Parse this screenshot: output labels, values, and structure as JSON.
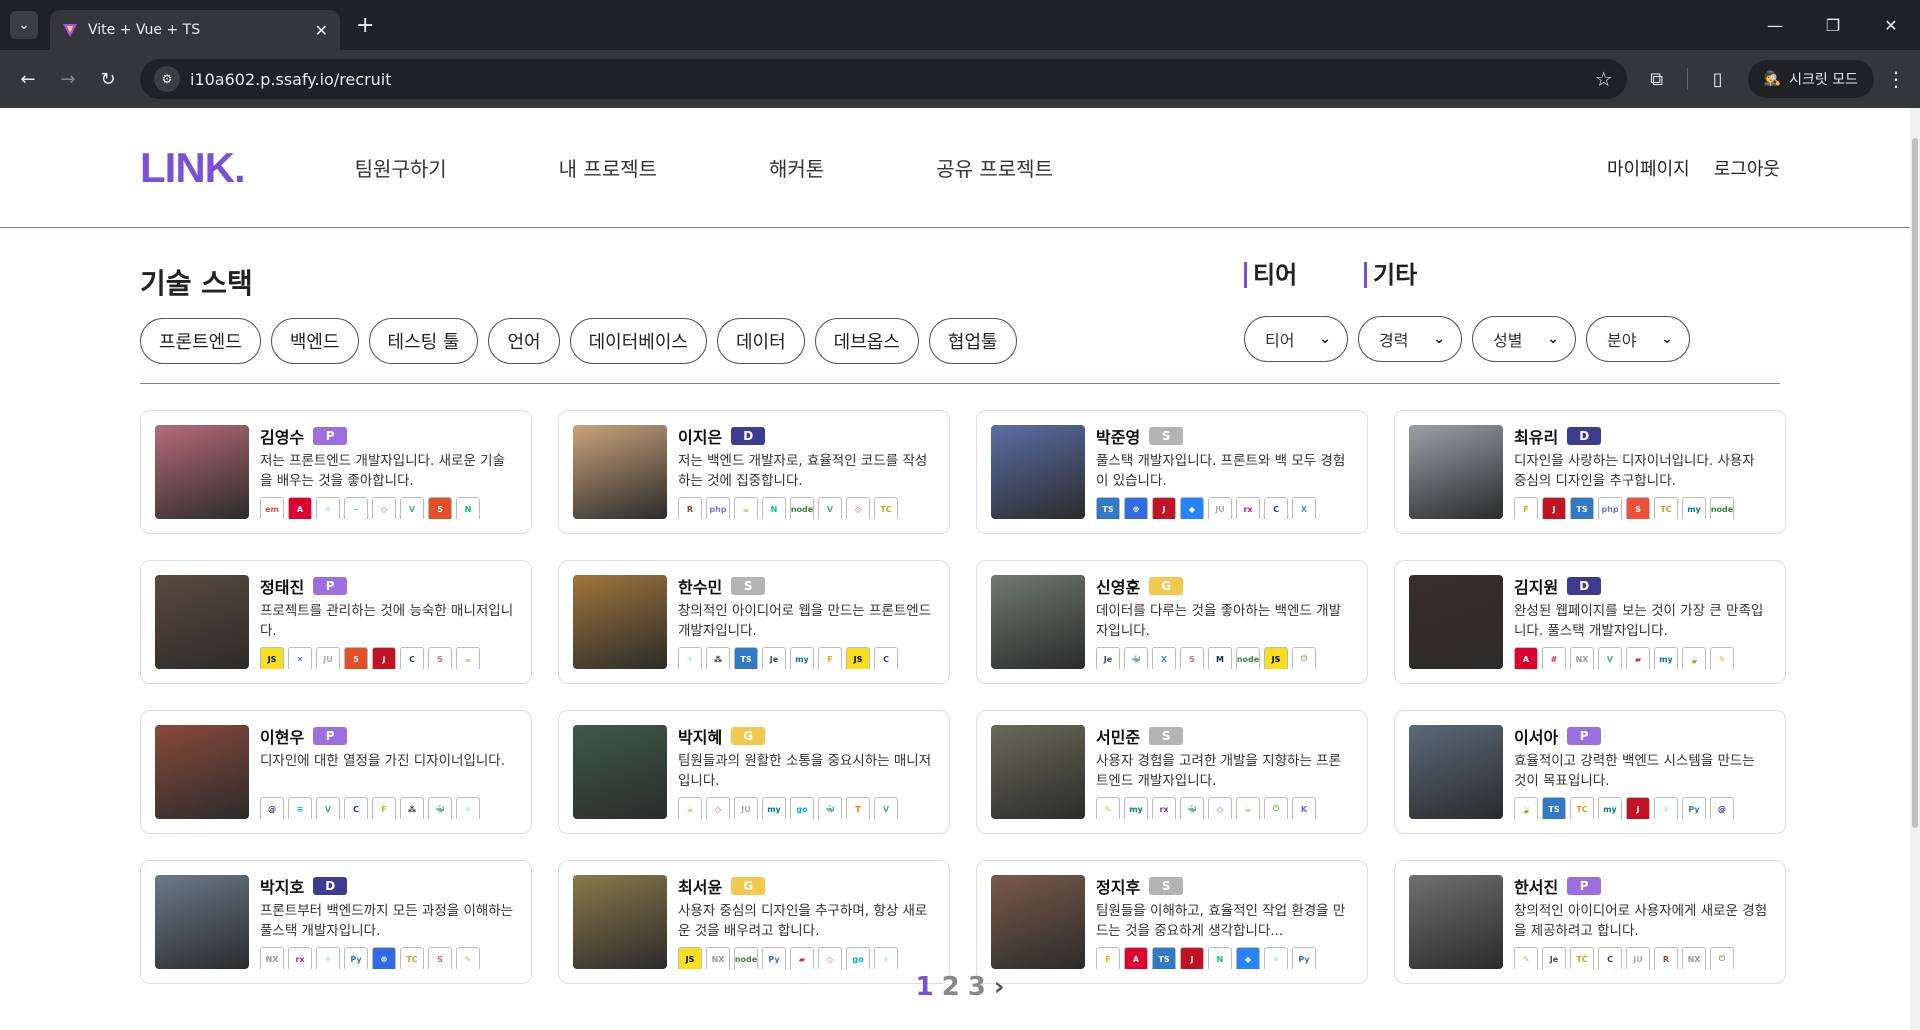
{
  "browser": {
    "tab_title": "Vite + Vue + TS",
    "url": "i10a602.p.ssafy.io/recruit",
    "incognito_label": "시크릿 모드"
  },
  "header": {
    "logo": "LINK.",
    "nav": [
      "팀원구하기",
      "내 프로젝트",
      "해커톤",
      "공유 프로젝트"
    ],
    "mypage": "마이페이지",
    "logout": "로그아웃"
  },
  "filters": {
    "stack_title": "기술 스택",
    "stack_buttons": [
      "프론트엔드",
      "백엔드",
      "테스팅 툴",
      "언어",
      "데이터베이스",
      "데이터",
      "데브옵스",
      "협업툴"
    ],
    "tier_title": "티어",
    "etc_title": "기타",
    "selects": [
      "티어",
      "경력",
      "성별",
      "분야"
    ]
  },
  "tier_colors": {
    "P": "#9b6fe0",
    "D": "#3d3b8e",
    "S": "#b3b3b3",
    "G": "#f2c94c"
  },
  "photo_colors": [
    "#b86a7a",
    "#c9a27a",
    "#5b6ea6",
    "#9aa0a6",
    "#5a4a3e",
    "#a0763a",
    "#6f7a72",
    "#3a2e2a",
    "#8a4a3a",
    "#3e5a4a",
    "#6a6a5a",
    "#5a6a7a",
    "#6a7a8a",
    "#8a7a4a",
    "#7a5a4a",
    "#707070"
  ],
  "members": [
    {
      "name": "김영수",
      "tier": "P",
      "desc": "저는 프론트엔드 개발자입니다. 새로운 기술을 배우는 것을 좋아합니다.",
      "icons": [
        "ember",
        "angular",
        "react",
        "tailwind",
        "graphql",
        "vue",
        "html5",
        "nuxt"
      ]
    },
    {
      "name": "이지은",
      "tier": "D",
      "desc": "저는 백엔드 개발자로, 효율적인 코드를 작성하는 것에 집중합니다.",
      "icons": [
        "rust",
        "php",
        "java",
        "nuxt",
        "node",
        "vue",
        "graphql",
        "tomcat"
      ]
    },
    {
      "name": "박준영",
      "tier": "S",
      "desc": "풀스택 개발자입니다. 프론트와 백 모두 경험이 있습니다.",
      "icons": [
        "ts",
        "k8s",
        "jest",
        "jira",
        "junit",
        "rxjs",
        "c",
        "xamarin"
      ]
    },
    {
      "name": "최유리",
      "tier": "D",
      "desc": "디자인을 사랑하는 디자이너입니다. 사용자 중심의 디자인을 추구합니다.",
      "icons": [
        "firebase",
        "jest",
        "ts",
        "php",
        "swift",
        "tomcat",
        "mysql",
        "node"
      ]
    },
    {
      "name": "정태진",
      "tier": "P",
      "desc": "프로젝트를 관리하는 것에 능숙한 매니저입니다.",
      "icons": [
        "js",
        "confluence",
        "junit",
        "html5",
        "jest",
        "c",
        "sass",
        "java"
      ]
    },
    {
      "name": "한수민",
      "tier": "S",
      "desc": "창의적인 아이디어로 웹을 만드는 프론트엔드 개발자입니다.",
      "icons": [
        "react",
        "figma",
        "ts",
        "jenkins",
        "mysql",
        "firebase",
        "js",
        "c"
      ]
    },
    {
      "name": "신영훈",
      "tier": "G",
      "desc": "데이터를 다루는 것을 좋아하는 백엔드 개발자입니다.",
      "icons": [
        "jenkins",
        "docker",
        "xamarin",
        "sass",
        "mariadb",
        "node",
        "js",
        "spring"
      ]
    },
    {
      "name": "김지원",
      "tier": "D",
      "desc": "완성된 웹페이지를 보는 것이 가장 큰 만족입니다. 풀스택 개발자입니다.",
      "icons": [
        "angular",
        "slack",
        "next",
        "vue",
        "redis",
        "mysql",
        "mongo",
        "pen"
      ]
    },
    {
      "name": "이현우",
      "tier": "P",
      "desc": "디자인에 대한 열정을 가진 디자이너입니다.",
      "icons": [
        "apollo",
        "elastic",
        "vue",
        "c",
        "firebase",
        "figma",
        "docker",
        "react"
      ]
    },
    {
      "name": "박지혜",
      "tier": "G",
      "desc": "팀원들과의 원활한 소통을 중요시하는 매니저입니다.",
      "icons": [
        "java",
        "graphql",
        "junit",
        "mysql",
        "go",
        "docker",
        "tensor",
        "vue"
      ]
    },
    {
      "name": "서민준",
      "tier": "S",
      "desc": "사용자 경험을 고려한 개발을 지향하는 프론트엔드 개발자입니다.",
      "icons": [
        "pen",
        "mysql",
        "rxjs",
        "docker",
        "graphql",
        "java",
        "spring",
        "kotlin"
      ]
    },
    {
      "name": "이서아",
      "tier": "P",
      "desc": "효율적이고 강력한 백엔드 시스템을 만드는 것이 목표입니다.",
      "icons": [
        "mongo",
        "ts",
        "tomcat",
        "mysql",
        "jest",
        "react",
        "python",
        "apollo"
      ]
    },
    {
      "name": "박지호",
      "tier": "D",
      "desc": "프론트부터 백엔드까지 모든 과정을 이해하는 풀스택 개발자입니다.",
      "icons": [
        "next",
        "rxjs",
        "react",
        "python",
        "k8s",
        "tomcat",
        "sass",
        "pen"
      ]
    },
    {
      "name": "최서윤",
      "tier": "G",
      "desc": "사용자 중심의 디자인을 추구하며, 항상 새로운 것을 배우려고 합니다.",
      "icons": [
        "js",
        "next",
        "node",
        "python",
        "redis",
        "graphql",
        "go",
        "react"
      ]
    },
    {
      "name": "정지후",
      "tier": "S",
      "desc": "팀원들을 이해하고, 효율적인 작업 환경을 만드는 것을 중요하게 생각합니다...",
      "icons": [
        "firebase",
        "angular",
        "ts",
        "jest",
        "nuxt",
        "jira",
        "react",
        "python"
      ]
    },
    {
      "name": "한서진",
      "tier": "P",
      "desc": "창의적인 아이디어로 사용자에게 새로운 경험을 제공하려고 합니다.",
      "icons": [
        "pen",
        "jenkins",
        "tomcat",
        "c",
        "junit",
        "rust",
        "next",
        "spring"
      ]
    }
  ],
  "icon_styles": {
    "ember": {
      "label": "em",
      "bg": "#fff",
      "fg": "#e04e39"
    },
    "angular": {
      "label": "A",
      "bg": "#dd0031",
      "fg": "#fff"
    },
    "react": {
      "label": "⚛",
      "bg": "#fff",
      "fg": "#61dafb"
    },
    "tailwind": {
      "label": "~",
      "bg": "#fff",
      "fg": "#38bdf8"
    },
    "graphql": {
      "label": "◇",
      "bg": "#fff",
      "fg": "#e535ab"
    },
    "vue": {
      "label": "V",
      "bg": "#fff",
      "fg": "#41b883"
    },
    "html5": {
      "label": "5",
      "bg": "#e34f26",
      "fg": "#fff"
    },
    "nuxt": {
      "label": "N",
      "bg": "#fff",
      "fg": "#00c58e"
    },
    "rust": {
      "label": "R",
      "bg": "#fff",
      "fg": "#8a4b28"
    },
    "php": {
      "label": "php",
      "bg": "#fff",
      "fg": "#777bb3"
    },
    "java": {
      "label": "☕",
      "bg": "#fff",
      "fg": "#e76f00"
    },
    "node": {
      "label": "node",
      "bg": "#fff",
      "fg": "#3c873a"
    },
    "tomcat": {
      "label": "TC",
      "bg": "#fff",
      "fg": "#d1a41a"
    },
    "ts": {
      "label": "TS",
      "bg": "#3178c6",
      "fg": "#fff"
    },
    "k8s": {
      "label": "☸",
      "bg": "#326ce5",
      "fg": "#fff"
    },
    "jest": {
      "label": "J",
      "bg": "#c21325",
      "fg": "#fff"
    },
    "jira": {
      "label": "◆",
      "bg": "#2684ff",
      "fg": "#fff"
    },
    "junit": {
      "label": "JU",
      "bg": "#fff",
      "fg": "#aaa"
    },
    "rxjs": {
      "label": "rx",
      "bg": "#fff",
      "fg": "#b7178c"
    },
    "c": {
      "label": "C",
      "bg": "#fff",
      "fg": "#283593"
    },
    "xamarin": {
      "label": "X",
      "bg": "#fff",
      "fg": "#3498db"
    },
    "firebase": {
      "label": "F",
      "bg": "#fff",
      "fg": "#ffa000"
    },
    "swift": {
      "label": "S",
      "bg": "#f05138",
      "fg": "#fff"
    },
    "mysql": {
      "label": "my",
      "bg": "#fff",
      "fg": "#00758f"
    },
    "js": {
      "label": "JS",
      "bg": "#f7df1e",
      "fg": "#000"
    },
    "confluence": {
      "label": "✕",
      "bg": "#fff",
      "fg": "#0052cc"
    },
    "sass": {
      "label": "S",
      "bg": "#fff",
      "fg": "#cc6699"
    },
    "figma": {
      "label": "⁂",
      "bg": "#fff",
      "fg": "#222"
    },
    "jenkins": {
      "label": "Je",
      "bg": "#fff",
      "fg": "#335061"
    },
    "docker": {
      "label": "🐳",
      "bg": "#fff",
      "fg": "#2496ed"
    },
    "mariadb": {
      "label": "M",
      "bg": "#fff",
      "fg": "#003545"
    },
    "spring": {
      "label": "⏻",
      "bg": "#fff",
      "fg": "#6db33f"
    },
    "slack": {
      "label": "#",
      "bg": "#fff",
      "fg": "#e01e5a"
    },
    "next": {
      "label": "NX",
      "bg": "#fff",
      "fg": "#999"
    },
    "redis": {
      "label": "▰",
      "bg": "#fff",
      "fg": "#d82c20"
    },
    "mongo": {
      "label": "🍃",
      "bg": "#fff",
      "fg": "#47a248"
    },
    "pen": {
      "label": "✎",
      "bg": "#fff",
      "fg": "#f5a623"
    },
    "apollo": {
      "label": "@",
      "bg": "#fff",
      "fg": "#311c87"
    },
    "elastic": {
      "label": "≡",
      "bg": "#fff",
      "fg": "#00bfb3"
    },
    "go": {
      "label": "go",
      "bg": "#fff",
      "fg": "#00add8"
    },
    "tensor": {
      "label": "T",
      "bg": "#fff",
      "fg": "#ff6f00"
    },
    "kotlin": {
      "label": "K",
      "bg": "#fff",
      "fg": "#7f52ff"
    },
    "python": {
      "label": "Py",
      "bg": "#fff",
      "fg": "#3776ab"
    }
  },
  "pagination": {
    "pages": [
      "1",
      "2",
      "3"
    ],
    "active": "1",
    "next": "›"
  }
}
